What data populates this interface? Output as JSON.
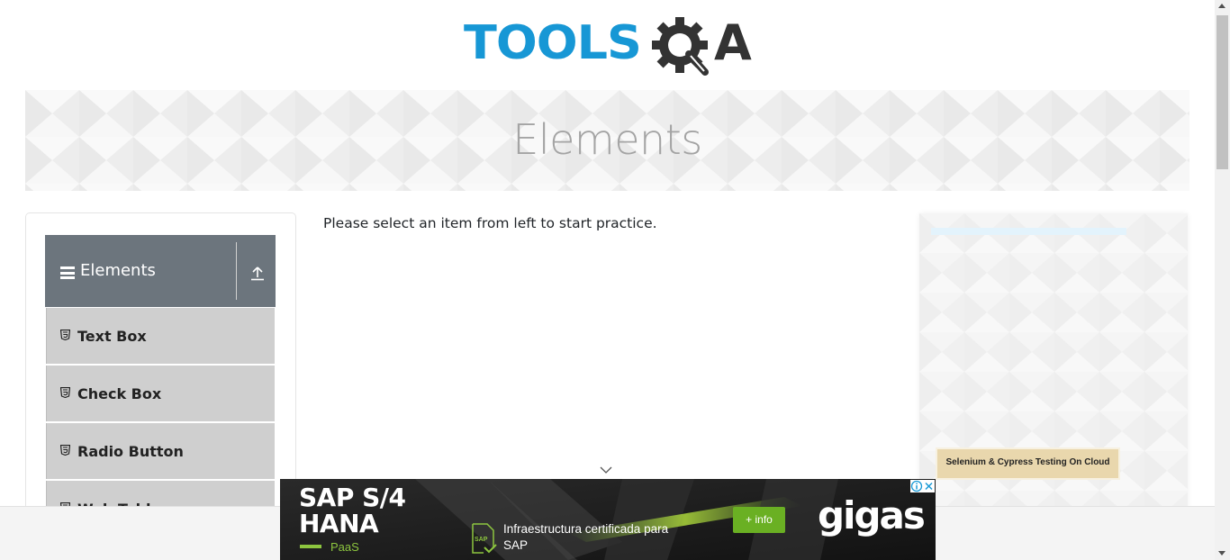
{
  "header": {
    "logo_text": "TOOLS",
    "logo_suffix": "A",
    "logo_gear_letter": "Q"
  },
  "banner": {
    "title": "Elements"
  },
  "sidebar": {
    "group_title": "Elements",
    "items": [
      {
        "label": "Text Box"
      },
      {
        "label": "Check Box"
      },
      {
        "label": "Radio Button"
      },
      {
        "label": "Web Tables"
      }
    ]
  },
  "main": {
    "instruction": "Please select an item from left to start practice."
  },
  "right_ad": {
    "cta": "Selenium & Cypress Testing On Cloud"
  },
  "bottom_ad": {
    "title_line1": "SAP S/4",
    "title_line2": "HANA",
    "tag": "PaaS",
    "icon_text": "SAP",
    "description": "Infraestructura certificada para SAP",
    "info_button": "+ info",
    "brand": "gigas"
  },
  "colors": {
    "brand_blue": "#1797d5",
    "group_header_bg": "#6c757d",
    "menu_item_bg": "#cfcfcf",
    "ad_green": "#8dc63f"
  }
}
